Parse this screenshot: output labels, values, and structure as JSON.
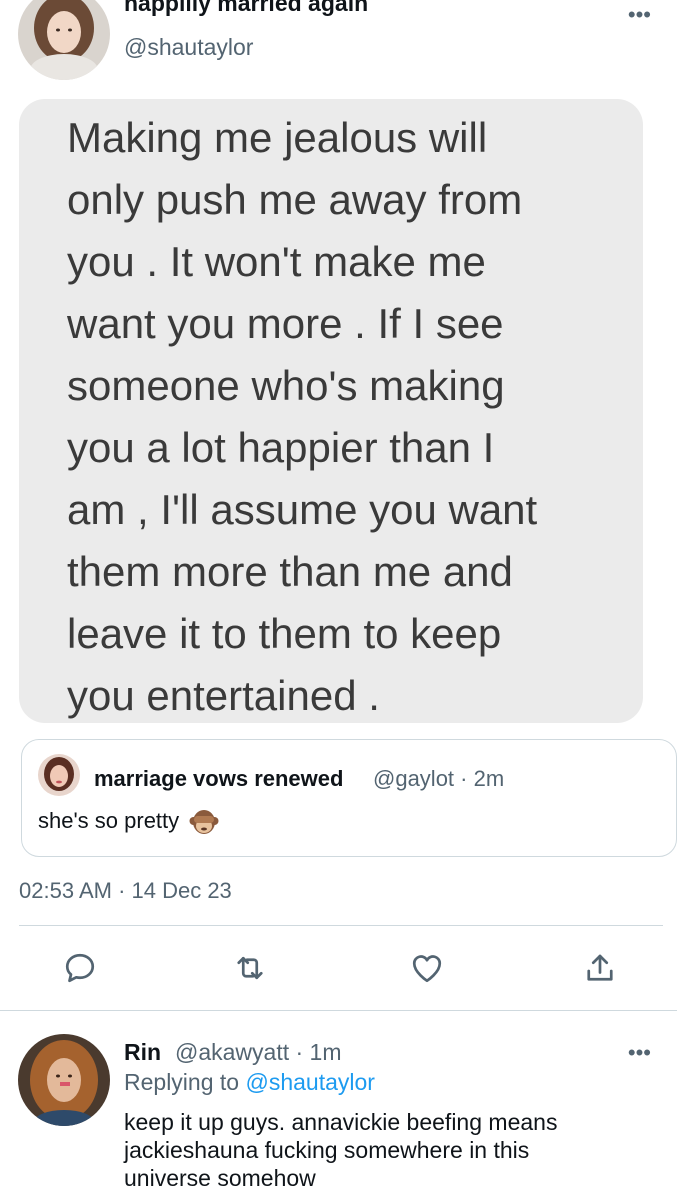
{
  "tweet": {
    "display_name": "happilly married again",
    "handle": "@shautaylor",
    "image_text_lines": [
      "Making me jealous will",
      "only push me away from",
      "you . It won't make me",
      "want you more . If I see",
      "someone who's making",
      "you a lot happier than I",
      "am , I'll assume you want",
      "them more than me and",
      "leave it to them to keep",
      "you entertained ."
    ],
    "quote": {
      "display_name": "marriage vows renewed",
      "meta": "@gaylot · 2m",
      "text": "she's so pretty",
      "emoji_icon": "see-no-evil-monkey-icon"
    },
    "timestamp": "02:53 AM · 14 Dec 23",
    "actions": [
      "reply-icon",
      "retweet-icon",
      "like-icon",
      "share-icon"
    ],
    "more_icon": "more-dots-icon"
  },
  "reply": {
    "display_name": "Rin",
    "meta": "@akawyatt · 1m",
    "replying_prefix": "Replying to",
    "replying_handle": "@shautaylor",
    "text_lines": [
      "keep it up guys. annavickie beefing means",
      "jackieshauna fucking somewhere in this",
      "universe somehow"
    ]
  },
  "colors": {
    "text": "#0f1419",
    "secondary": "#536471",
    "link": "#1d9bf0",
    "border": "#cfd9de",
    "card_bg": "#ebebeb"
  }
}
